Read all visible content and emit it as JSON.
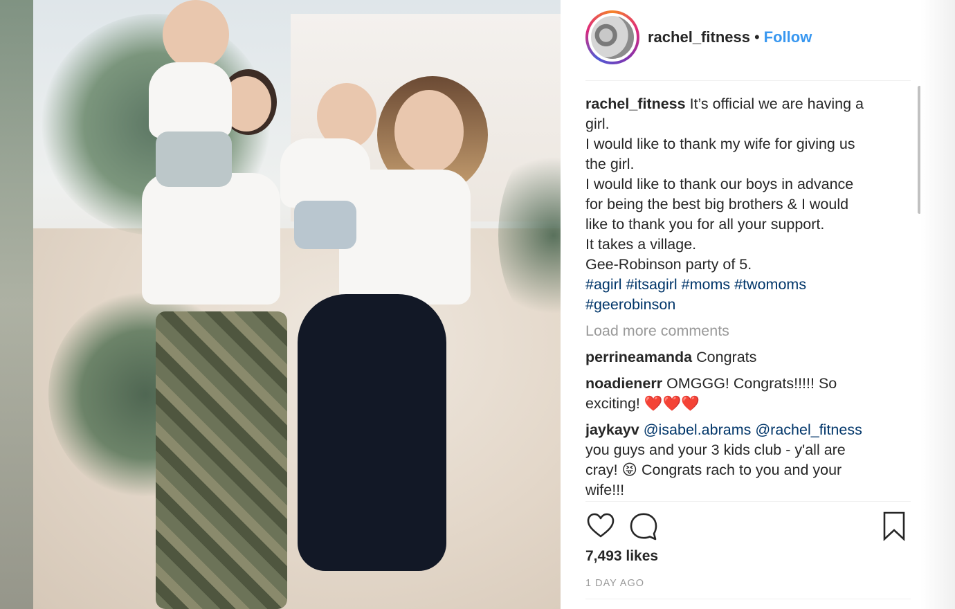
{
  "post": {
    "username": "rachel_fitness",
    "separator": "•",
    "follow_label": "Follow",
    "caption": {
      "username": "rachel_fitness",
      "lines": [
        "It’s official we are having a",
        "girl.",
        "I would like to thank my wife for giving us",
        "the girl.",
        "I would like to thank our boys in advance",
        "for being the best big brothers & I would",
        "like to thank you for all your support.",
        "It takes a village.",
        "Gee-Robinson party of 5."
      ],
      "hashtags_line1": [
        "#agirl",
        "#itsagirl",
        "#moms",
        "#twomoms"
      ],
      "hashtags_line2": [
        "#geerobinson"
      ]
    },
    "load_more_label": "Load more comments",
    "comments": [
      {
        "user": "perrineamanda",
        "text": "Congrats"
      },
      {
        "user": "noadienerr",
        "text": "OMGGG! Congrats!!!!! So",
        "text2": "exciting! ",
        "hearts": "❤️❤️❤️"
      },
      {
        "user": "jaykayv",
        "mention1": "@isabel.abrams",
        "mention2": "@rachel_fitness",
        "line2": "you guys and your 3 kids club - y'all are",
        "line3_a": "cray! ",
        "emoji": "😝",
        "line3_b": " Congrats rach to you and your",
        "line4": "wife!!!"
      }
    ],
    "likes_text": "7,493 likes",
    "time_text": "1 DAY AGO"
  },
  "icons": {
    "like": "heart-outline-icon",
    "comment": "speech-bubble-icon",
    "save": "bookmark-icon"
  }
}
